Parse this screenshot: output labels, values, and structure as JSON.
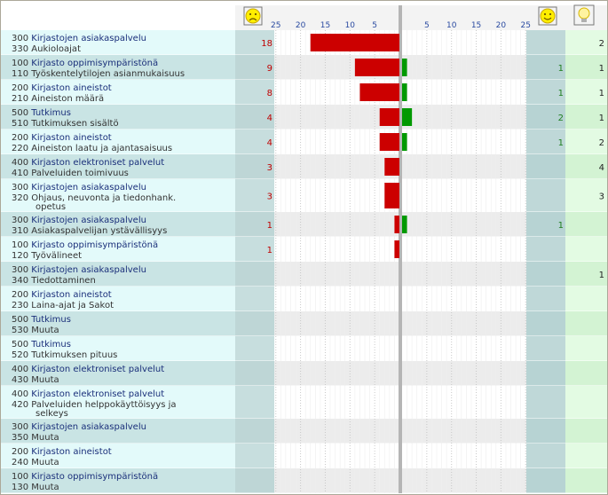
{
  "headers": {
    "negative_icon": "sad-face-icon",
    "positive_icon": "happy-face-icon",
    "idea_icon": "lightbulb-icon",
    "negative_ticks": [
      "25",
      "20",
      "15",
      "10",
      "5"
    ],
    "positive_ticks": [
      "5",
      "10",
      "15",
      "20",
      "25"
    ]
  },
  "colors": {
    "negative": "#cc0000",
    "positive": "#009900",
    "label_bg_a": "#e3fafa",
    "label_bg_b": "#c9e4e4"
  },
  "chart_data": {
    "type": "bar",
    "xlim": [
      0,
      25
    ],
    "categories": [
      {
        "code1": "300",
        "cat": "Kirjastojen asiakaspalvelu",
        "code2": "330",
        "sub": "Aukioloajat"
      },
      {
        "code1": "100",
        "cat": "Kirjasto oppimisympäristönä",
        "code2": "110",
        "sub": "Työskentelytilojen asianmukaisuus"
      },
      {
        "code1": "200",
        "cat": "Kirjaston aineistot",
        "code2": "210",
        "sub": "Aineiston määrä"
      },
      {
        "code1": "500",
        "cat": "Tutkimus",
        "code2": "510",
        "sub": "Tutkimuksen sisältö"
      },
      {
        "code1": "200",
        "cat": "Kirjaston aineistot",
        "code2": "220",
        "sub": "Aineiston laatu ja ajantasaisuus"
      },
      {
        "code1": "400",
        "cat": "Kirjaston elektroniset palvelut",
        "code2": "410",
        "sub": "Palveluiden toimivuus"
      },
      {
        "code1": "300",
        "cat": "Kirjastojen asiakaspalvelu",
        "code2": "320",
        "sub": "Ohjaus, neuvonta ja tiedonhank.",
        "sub2": "opetus"
      },
      {
        "code1": "300",
        "cat": "Kirjastojen asiakaspalvelu",
        "code2": "310",
        "sub": "Asiakaspalvelijan ystävällisyys"
      },
      {
        "code1": "100",
        "cat": "Kirjasto oppimisympäristönä",
        "code2": "120",
        "sub": "Työvälineet"
      },
      {
        "code1": "300",
        "cat": "Kirjastojen asiakaspalvelu",
        "code2": "340",
        "sub": "Tiedottaminen"
      },
      {
        "code1": "200",
        "cat": "Kirjaston aineistot",
        "code2": "230",
        "sub": "Laina-ajat ja Sakot"
      },
      {
        "code1": "500",
        "cat": "Tutkimus",
        "code2": "530",
        "sub": "Muuta"
      },
      {
        "code1": "500",
        "cat": "Tutkimus",
        "code2": "520",
        "sub": "Tutkimuksen pituus"
      },
      {
        "code1": "400",
        "cat": "Kirjaston elektroniset palvelut",
        "code2": "430",
        "sub": "Muuta"
      },
      {
        "code1": "400",
        "cat": "Kirjaston elektroniset palvelut",
        "code2": "420",
        "sub": "Palveluiden helppokäyttöisyys ja",
        "sub2": "selkeys"
      },
      {
        "code1": "300",
        "cat": "Kirjastojen asiakaspalvelu",
        "code2": "350",
        "sub": "Muuta"
      },
      {
        "code1": "200",
        "cat": "Kirjaston aineistot",
        "code2": "240",
        "sub": "Muuta"
      },
      {
        "code1": "100",
        "cat": "Kirjasto oppimisympäristönä",
        "code2": "130",
        "sub": "Muuta"
      }
    ],
    "series": [
      {
        "values": [
          18,
          9,
          8,
          4,
          4,
          3,
          3,
          1,
          1,
          0,
          0,
          0,
          0,
          0,
          0,
          0,
          0,
          0
        ]
      },
      {
        "values": [
          0,
          1,
          1,
          2,
          1,
          0,
          0,
          1,
          0,
          0,
          0,
          0,
          0,
          0,
          0,
          0,
          0,
          0
        ]
      },
      {
        "values": [
          2,
          1,
          1,
          1,
          2,
          4,
          3,
          0,
          0,
          1,
          0,
          0,
          0,
          0,
          0,
          0,
          0,
          0
        ]
      }
    ]
  }
}
